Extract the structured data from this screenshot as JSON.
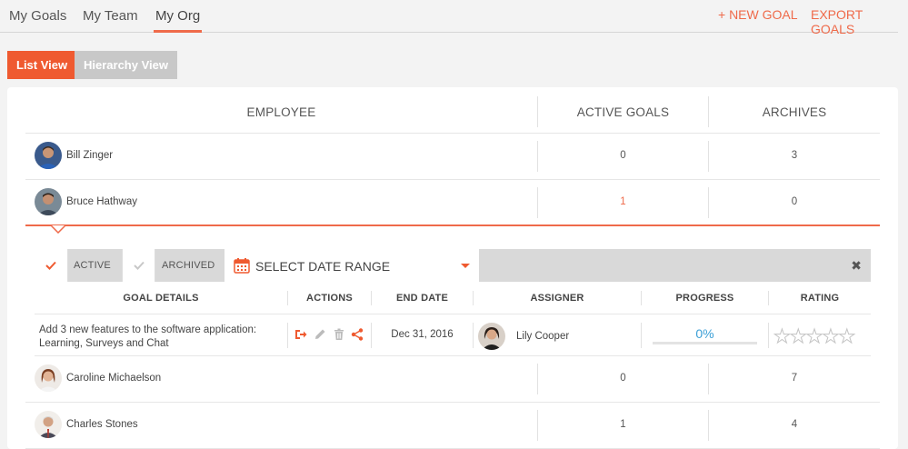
{
  "top_tabs": [
    {
      "label": "My Goals"
    },
    {
      "label": "My Team"
    },
    {
      "label": "My Org"
    }
  ],
  "active_top_tab": "My Org",
  "actions": {
    "new_goal": "+ NEW GOAL",
    "export_goals": "EXPORT GOALS"
  },
  "view_toggle": {
    "list": "List View",
    "hierarchy": "Hierarchy View",
    "active": "List View"
  },
  "table": {
    "headers": {
      "employee": "EMPLOYEE",
      "active_goals": "ACTIVE GOALS",
      "archives": "ARCHIVES"
    },
    "rows": [
      {
        "name": "Bill Zinger",
        "active_goals": "0",
        "archives": "3"
      },
      {
        "name": "Bruce Hathway",
        "active_goals": "1",
        "archives": "0",
        "expanded": true
      },
      {
        "name": "Caroline Michaelson",
        "active_goals": "0",
        "archives": "7"
      },
      {
        "name": "Charles Stones",
        "active_goals": "1",
        "archives": "4"
      }
    ]
  },
  "goal_filter": {
    "active_label": "ACTIVE",
    "active_checked": true,
    "archived_label": "ARCHIVED",
    "archived_checked": false,
    "date_range_placeholder": "SELECT DATE RANGE"
  },
  "goals_table": {
    "headers": {
      "goal_details": "GOAL DETAILS",
      "actions": "ACTIONS",
      "end_date": "END DATE",
      "assigner": "ASSIGNER",
      "progress": "PROGRESS",
      "rating": "RATING"
    },
    "goals": [
      {
        "details": "Add 3 new features to the software application: Learning, Surveys and Chat",
        "actions": [
          "share-out-icon",
          "pencil-icon",
          "trash-icon",
          "share-icon"
        ],
        "end_date": "Dec 31, 2016",
        "assigner": "Lily Cooper",
        "progress_text": "0%",
        "progress_fraction": 0,
        "rating": 0,
        "rating_max": 5
      }
    ]
  },
  "colors": {
    "accent": "#ef5a30",
    "progress": "#3b9fd6",
    "inactive_toggle": "#c8c8c8"
  }
}
